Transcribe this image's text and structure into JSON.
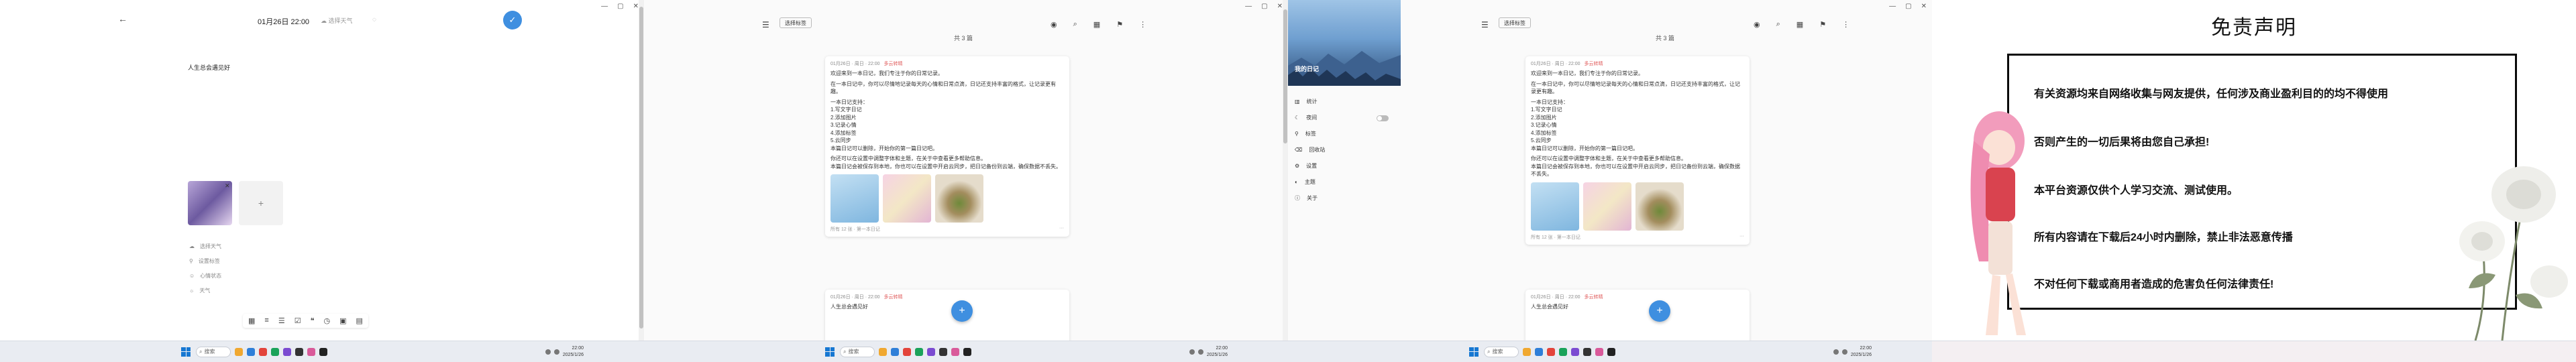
{
  "panel1": {
    "date": "01月26日 22:00",
    "weather": "☁ 选择天气",
    "body_text": "人生总会遇见好",
    "meta": [
      "选择天气",
      "设置标签",
      "心情状态",
      "天气"
    ]
  },
  "list": {
    "chip": "选择标签",
    "month": "共 3 篇",
    "card1": {
      "date": "01月26日 · 周日 · 22:00",
      "weather": "多云转晴",
      "paragraphs": [
        "欢迎来到一本日记，我们专注于你的日常记录。",
        "在一本日记中，你可以尽情地记录每天的心情和日常点滴，日记还支持丰富的格式，让记录更有趣。",
        "一本日记支持：",
        "1.写文字日记",
        "2.添加图片",
        "3.记录心情",
        "4.添加标签",
        "5.云同步",
        "本篇日记可以删除，开始你的第一篇日记吧。",
        "你还可以在设置中调整字体和主题，在关于中查看更多帮助信息。",
        "本篇日记会被保存到本地，你也可以在设置中开启云同步，把日记备份到云端，确保数据不丢失。"
      ],
      "footer_left": "所有 12 张 · 第一本日记",
      "footer_right": "···"
    },
    "card2": {
      "date": "01月26日 · 周日 · 22:00",
      "weather": "多云转晴",
      "text": "人生总会遇见好"
    }
  },
  "drawer": {
    "title": "我的日记",
    "items": [
      "统计",
      "夜间",
      "标签",
      "回收站",
      "设置",
      "主题",
      "关于"
    ]
  },
  "disclaimer": {
    "title": "免责声明",
    "lines": [
      "有关资源均来自网络收集与网友提供，任何涉及商业盈利目的的均不得使用",
      "否则产生的一切后果将由您自己承担!",
      "本平台资源仅供个人学习交流、测试使用。",
      "所有内容请在下载后24小时内删除，禁止非法恶意传播",
      "不对任何下载或商用者造成的危害负任何法律责任!"
    ]
  },
  "taskbar": {
    "search": "搜索",
    "time": "22:00",
    "date": "2025/1/26"
  },
  "colors": {
    "accent": "#3f8fe0",
    "weather_red": "#e05a5a"
  }
}
